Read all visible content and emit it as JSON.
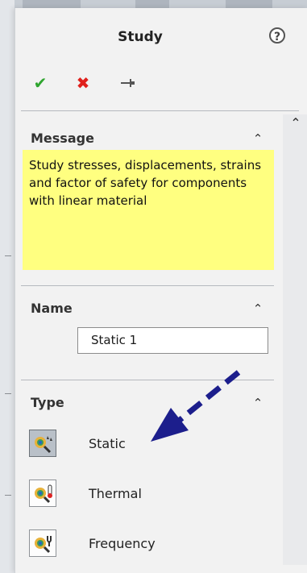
{
  "panel": {
    "title": "Study",
    "help_icon": "question-circle-icon",
    "actions": {
      "ok_icon": "check-icon",
      "cancel_icon": "close-icon",
      "pin_icon": "pushpin-icon"
    }
  },
  "groups": {
    "message": {
      "title": "Message",
      "text": "Study stresses, displacements, strains and factor of safety  for components with linear material",
      "background": "#ffff80"
    },
    "name": {
      "title": "Name",
      "value": "Static 1"
    },
    "type": {
      "title": "Type",
      "options": [
        {
          "label": "Static",
          "icon": "static-study-icon",
          "selected": true
        },
        {
          "label": "Thermal",
          "icon": "thermal-study-icon",
          "selected": false
        },
        {
          "label": "Frequency",
          "icon": "frequency-study-icon",
          "selected": false
        }
      ]
    }
  },
  "colors": {
    "ok": "#2fa52f",
    "cancel": "#e0201c",
    "annotation_arrow": "#1c1e8c"
  }
}
